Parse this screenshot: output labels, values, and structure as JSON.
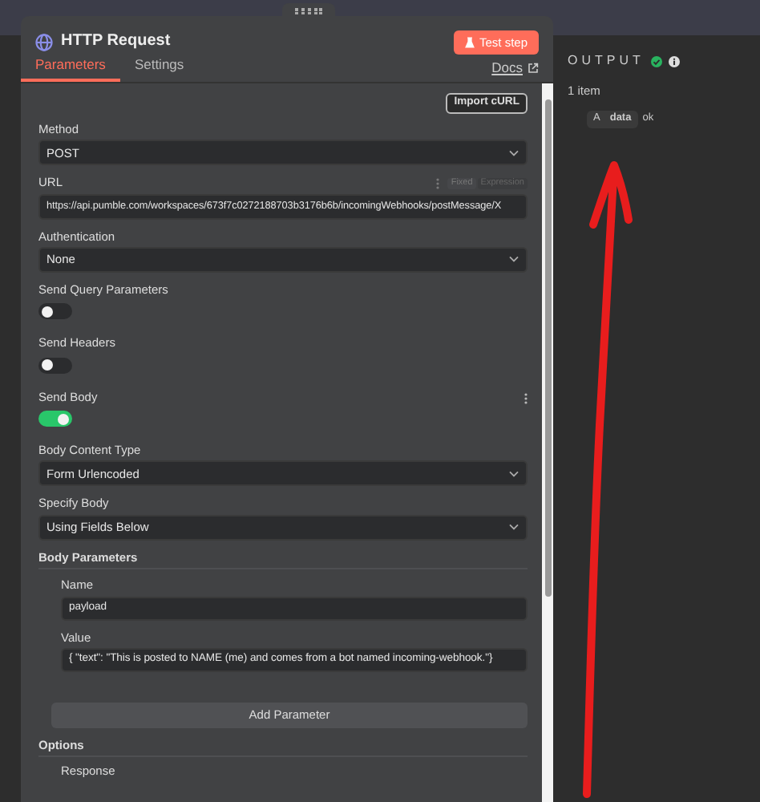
{
  "node": {
    "title": "HTTP Request",
    "test_button": "Test step",
    "docs_link": "Docs",
    "tabs": [
      {
        "label": "Parameters",
        "selected": true
      },
      {
        "label": "Settings",
        "selected": false
      }
    ]
  },
  "import_button": "Import cURL",
  "fields": [
    {
      "kind": "select",
      "label": "Method",
      "value": "POST"
    },
    {
      "kind": "text",
      "label": "URL",
      "value": "https://api.pumble.com/workspaces/673f7c0272188703b3176b6b/incomingWebhooks/postMessage/X",
      "modes": [
        {
          "label": "Fixed",
          "selected": true
        },
        {
          "label": "Expression",
          "selected": false
        }
      ]
    },
    {
      "kind": "select",
      "label": "Authentication",
      "value": "None"
    },
    {
      "kind": "toggle",
      "label": "Send Query Parameters",
      "on": false
    },
    {
      "kind": "toggle",
      "label": "Send Headers",
      "on": false
    },
    {
      "kind": "toggle",
      "label": "Send Body",
      "on": true,
      "menu": true
    },
    {
      "kind": "select",
      "label": "Body Content Type",
      "value": "Form Urlencoded"
    },
    {
      "kind": "select",
      "label": "Specify Body",
      "value": "Using Fields Below"
    }
  ],
  "body_parameters": {
    "title": "Body Parameters",
    "add_button": "Add Parameter",
    "fields": [
      {
        "label": "Name",
        "value": "payload"
      },
      {
        "label": "Value",
        "value": "{ \"text\": \"This is posted to NAME (me) and comes from a bot named incoming-webhook.\"}"
      }
    ]
  },
  "options": {
    "title": "Options",
    "items": [
      "Response"
    ]
  },
  "output": {
    "title": "OUTPUT",
    "count": "1 item",
    "rows": [
      {
        "type": "A",
        "key": "data",
        "value": "ok"
      }
    ]
  }
}
